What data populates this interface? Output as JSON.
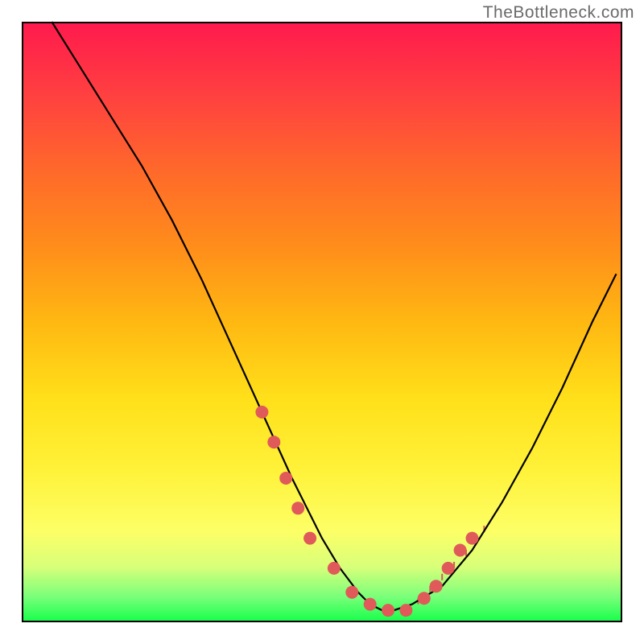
{
  "watermark": "TheBottleneck.com",
  "chart_data": {
    "type": "line",
    "title": "",
    "xlabel": "",
    "ylabel": "",
    "xlim": [
      0,
      100
    ],
    "ylim": [
      0,
      100
    ],
    "series": [
      {
        "name": "curve",
        "x": [
          5,
          10,
          15,
          20,
          25,
          30,
          35,
          40,
          45,
          50,
          53,
          56,
          58,
          60,
          62,
          65,
          70,
          75,
          80,
          85,
          90,
          95,
          99
        ],
        "values": [
          100,
          92,
          84,
          76,
          67,
          57,
          46,
          35,
          24,
          14,
          9,
          5,
          3,
          2,
          2,
          3,
          6,
          12,
          20,
          29,
          39,
          50,
          58
        ]
      }
    ],
    "markers": {
      "name": "dots",
      "x": [
        40,
        42,
        44,
        46,
        48,
        52,
        55,
        58,
        61,
        64,
        67,
        69,
        71,
        73,
        75
      ],
      "y": [
        35,
        30,
        24,
        19,
        14,
        9,
        5,
        3,
        2,
        2,
        4,
        6,
        9,
        12,
        14
      ],
      "color": "#e05a5a",
      "radius": 8
    },
    "ticks": {
      "x": [
        66,
        68,
        70,
        72,
        74,
        75,
        77
      ],
      "y0": [
        3,
        5,
        7,
        9,
        11,
        13,
        15
      ],
      "len": 8
    }
  }
}
